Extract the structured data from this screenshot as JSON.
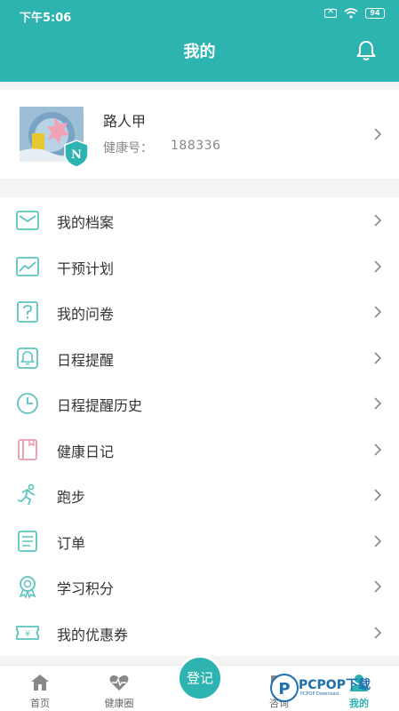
{
  "status_bar": {
    "time": "下午5:06",
    "battery": "94"
  },
  "header": {
    "title": "我的"
  },
  "profile": {
    "name": "路人甲",
    "id_label": "健康号：",
    "id_value": "188336"
  },
  "menu": [
    {
      "label": "我的档案",
      "icon": "mail-icon"
    },
    {
      "label": "干预计划",
      "icon": "chart-line-icon"
    },
    {
      "label": "我的问卷",
      "icon": "question-icon"
    },
    {
      "label": "日程提醒",
      "icon": "bell-icon"
    },
    {
      "label": "日程提醒历史",
      "icon": "clock-icon"
    },
    {
      "label": "健康日记",
      "icon": "diary-icon"
    },
    {
      "label": "跑步",
      "icon": "runner-icon"
    },
    {
      "label": "订单",
      "icon": "order-icon"
    },
    {
      "label": "学习积分",
      "icon": "medal-icon"
    },
    {
      "label": "我的优惠券",
      "icon": "coupon-icon"
    }
  ],
  "bottom_nav": [
    {
      "label": "首页",
      "icon": "home-icon"
    },
    {
      "label": "健康圈",
      "icon": "heart-icon"
    },
    {
      "label": "登记",
      "icon": "register-button"
    },
    {
      "label": "咨询",
      "icon": "chat-icon"
    },
    {
      "label": "我的",
      "icon": "person-icon"
    }
  ],
  "watermark": {
    "text": "PCPOP下载",
    "sub": "PCPOP Download"
  },
  "colors": {
    "accent": "#2db3b0",
    "icon_teal": "#5bc4c1",
    "icon_pink": "#e89aa8"
  }
}
